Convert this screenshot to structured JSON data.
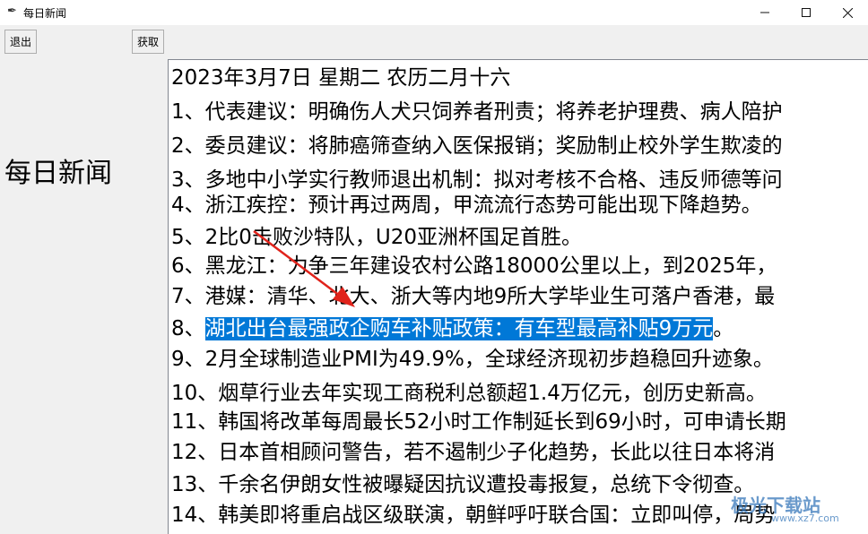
{
  "window": {
    "title": "每日新闻"
  },
  "toolbar": {
    "quit_label": "退出",
    "fetch_label": "获取"
  },
  "sidebar": {
    "title": "每日新闻"
  },
  "content": {
    "date_line": "2023年3月7日 星期二 农历二月十六",
    "lines": [
      "1、代表建议：明确伤人犬只饲养者刑责；将养老护理费、病人陪护",
      "2、委员建议：将肺癌筛查纳入医保报销；奖励制止校外学生欺凌的",
      "3、多地中小学实行教师退出机制：拟对考核不合格、违反师德等问",
      "4、浙江疾控：预计再过两周，甲流流行态势可能出现下降趋势。",
      "5、2比0击败沙特队，U20亚洲杯国足首胜。",
      "6、黑龙江：力争三年建设农村公路18000公里以上，到2025年，",
      "7、港媒：清华、北大、浙大等内地9所大学毕业生可落户香港，最",
      "8、",
      "9、2月全球制造业PMI为49.9%，全球经济现初步趋稳回升迹象。",
      "10、烟草行业去年实现工商税利总额超1.4万亿元，创历史新高。",
      "11、韩国将改革每周最长52小时工作制延长到69小时，可申请长期",
      "12、日本首相顾问警告，若不遏制少子化趋势，长此以往日本将消",
      "13、千余名伊朗女性被曝疑因抗议遭投毒报复，总统下令彻查。",
      "14、韩美即将重启战区级联演，朝鲜呼吁联合国：立即叫停，局势"
    ],
    "selected_text": "湖北出台最强政企购车补贴政策：有车型最高补贴9万元",
    "selected_suffix": "。"
  },
  "watermark": {
    "text": "极光下载站",
    "sub": "www.xz7.com"
  },
  "colors": {
    "selection": "#0078d7",
    "arrow": "#e0231b"
  }
}
